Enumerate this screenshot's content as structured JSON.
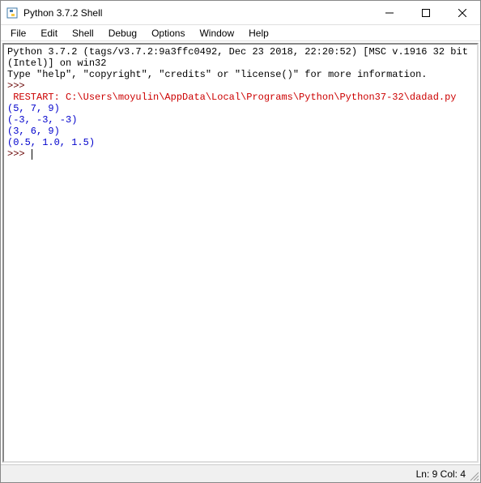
{
  "window": {
    "title": "Python 3.7.2 Shell"
  },
  "menu": {
    "file": "File",
    "edit": "Edit",
    "shell": "Shell",
    "debug": "Debug",
    "options": "Options",
    "window": "Window",
    "help": "Help"
  },
  "shell": {
    "banner_line1": "Python 3.7.2 (tags/v3.7.2:9a3ffc0492, Dec 23 2018, 22:20:52) [MSC v.1916 32 bit (Intel)] on win32",
    "banner_line2": "Type \"help\", \"copyright\", \"credits\" or \"license()\" for more information.",
    "prompt1": ">>> ",
    "restart_line": " RESTART: C:\\Users\\moyulin\\AppData\\Local\\Programs\\Python\\Python37-32\\dadad.py ",
    "out1": "(5, 7, 9)",
    "out2": "(-3, -3, -3)",
    "out3": "(3, 6, 9)",
    "out4": "(0.5, 1.0, 1.5)",
    "prompt2": ">>> "
  },
  "status": {
    "position": "Ln: 9  Col: 4"
  }
}
